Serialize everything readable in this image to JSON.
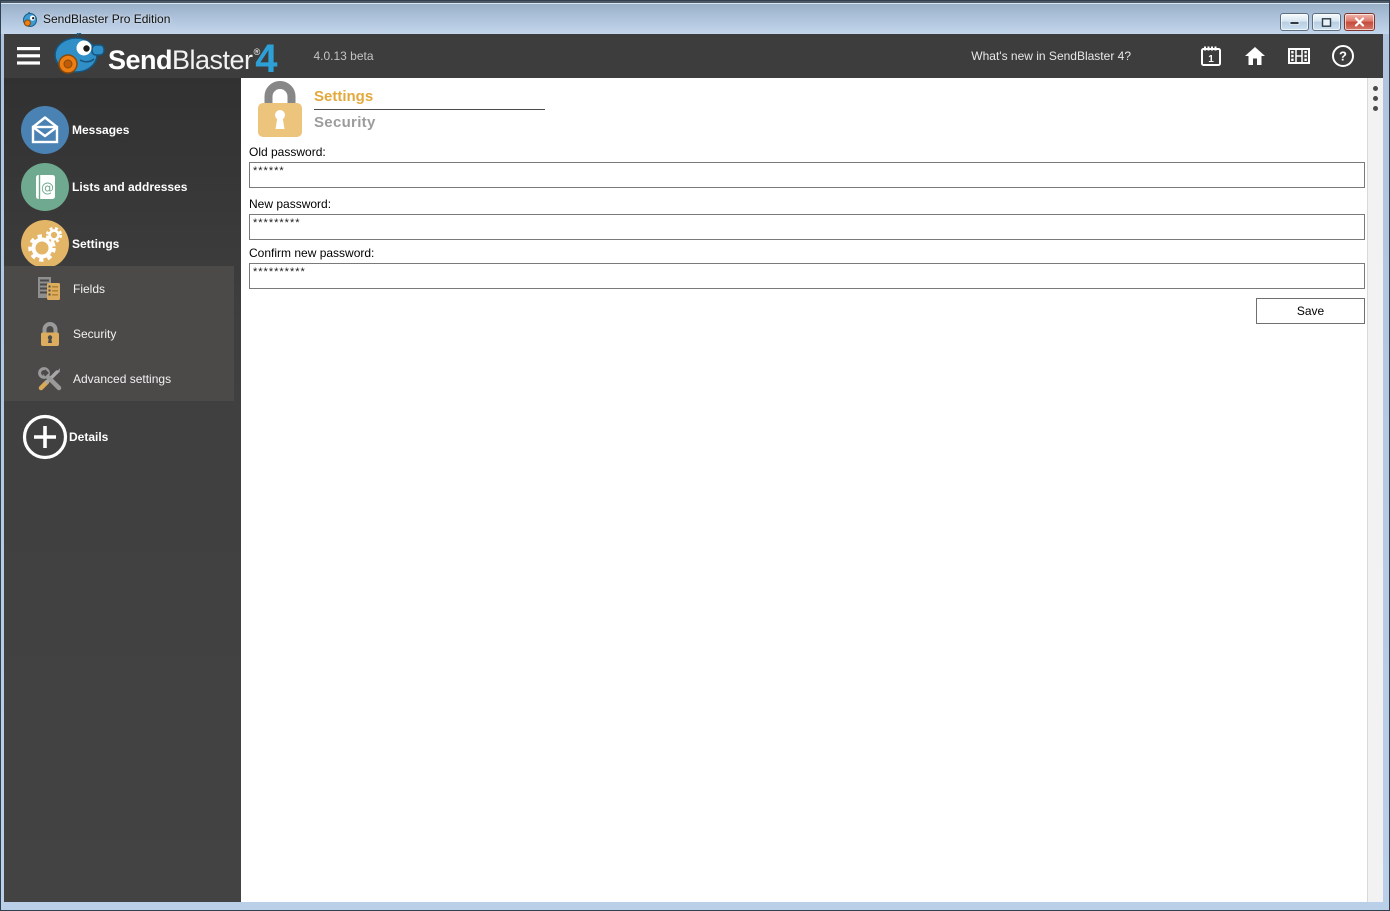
{
  "window": {
    "title": "SendBlaster Pro Edition"
  },
  "toolbar": {
    "logo": {
      "send": "Send",
      "blaster": "Blaster",
      "reg": "®",
      "four": "4"
    },
    "version": "4.0.13 beta",
    "whats_new": "What's new in SendBlaster 4?",
    "icons": [
      "calendar",
      "home",
      "video",
      "help"
    ]
  },
  "sidebar": {
    "messages": "Messages",
    "lists": "Lists and addresses",
    "settings": "Settings",
    "fields": "Fields",
    "security": "Security",
    "advanced": "Advanced settings",
    "details": "Details"
  },
  "main": {
    "breadcrumb_parent": "Settings",
    "breadcrumb_current": "Security",
    "old_password_label": "Old password:",
    "old_password_value": "******",
    "new_password_label": "New password:",
    "new_password_value": "*********",
    "confirm_password_label": "Confirm new password:",
    "confirm_password_value": "**********",
    "save_label": "Save"
  },
  "colors": {
    "accent_blue": "#2da0d8",
    "messages_circle": "#4a82b4",
    "lists_circle": "#6fa98f",
    "settings_circle": "#e3b566",
    "gold": "#e2a93d"
  }
}
